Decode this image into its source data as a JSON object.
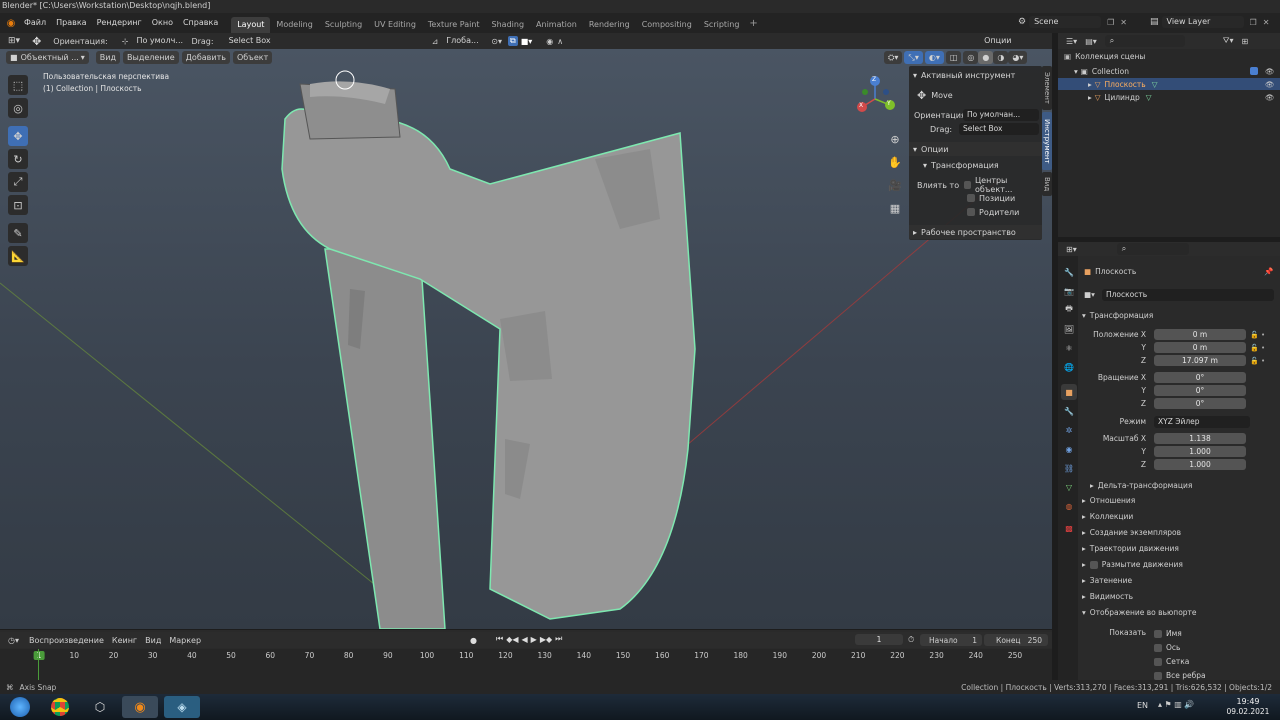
{
  "titlebar": {
    "text": "Blender* [C:\\Users\\Workstation\\Desktop\\nqjh.blend]"
  },
  "menu": [
    "Файл",
    "Правка",
    "Рендеринг",
    "Окно",
    "Справка"
  ],
  "workspaces": [
    "Layout",
    "Modeling",
    "Sculpting",
    "UV Editing",
    "Texture Paint",
    "Shading",
    "Animation",
    "Rendering",
    "Compositing",
    "Scripting"
  ],
  "scene": {
    "name": "Scene",
    "view_layer": "View Layer"
  },
  "header": {
    "orientation_label": "Ориентация:",
    "orientation_value": "По умолч...",
    "drag_label": "Drag:",
    "drag_value": "Select Box",
    "transform_space": "Глоба...",
    "options": "Опции"
  },
  "viewport_header": {
    "mode": "Объектный ...",
    "items": [
      "Вид",
      "Выделение",
      "Добавить",
      "Объект"
    ]
  },
  "viewport": {
    "perspective": "Пользовательская перспектива",
    "collection_info": "(1) Collection | Плоскость",
    "axes": {
      "x": "X",
      "y": "Y",
      "z": "Z"
    }
  },
  "colors": {
    "accent": "#4a7fd1",
    "selection_outline": "#7ee8b0",
    "active_tab": "#3f6fb5"
  },
  "npanel": {
    "active_tool_title": "Активный инструмент",
    "tool_name": "Move",
    "orientation_label": "Ориентация",
    "orientation_value": "По умолчан...",
    "drag_label": "Drag:",
    "drag_value": "Select Box",
    "options_title": "Опции",
    "transform_title": "Трансформация",
    "affect_label": "Влиять то...",
    "affect_items": [
      "Центры объект...",
      "Позиции",
      "Родители"
    ],
    "workspace_title": "Рабочее пространство",
    "tabs": [
      "Элемент",
      "Инструмент",
      "Вид"
    ]
  },
  "outliner": {
    "scene_collection": "Коллекция сцены",
    "items": [
      {
        "name": "Collection"
      },
      {
        "name": "Плоскость"
      },
      {
        "name": "Цилиндр"
      }
    ]
  },
  "properties": {
    "object_name": "Плоскость",
    "object_field": "Плоскость",
    "section_transform": "Трансформация",
    "location_label": "Положение X",
    "location": [
      "0 m",
      "0 m",
      "17.097 m"
    ],
    "rotation_label": "Вращение X",
    "rotation": [
      "0°",
      "0°",
      "0°"
    ],
    "mode_label": "Режим",
    "mode_value": "XYZ Эйлер",
    "scale_label": "Масштаб X",
    "scale": [
      "1.138",
      "1.000",
      "1.000"
    ],
    "axis_y": "Y",
    "axis_z": "Z",
    "delta": "Дельта-трансформация",
    "sections": [
      "Отношения",
      "Коллекции",
      "Создание экземпляров",
      "Траектории движения",
      "Размытие движения",
      "Затенение",
      "Видимость",
      "Отображение во вьюпорте"
    ],
    "show_label": "Показать",
    "show_items": [
      "Имя",
      "Ось",
      "Сетка",
      "Все ребра"
    ]
  },
  "timeline": {
    "menus": [
      "Воспроизведение",
      "Кеинг",
      "Вид",
      "Маркер"
    ],
    "current_frame": "1",
    "start_label": "Начало",
    "start": "1",
    "end_label": "Конец",
    "end": "250",
    "ticks": [
      "1",
      "10",
      "20",
      "30",
      "40",
      "50",
      "60",
      "70",
      "80",
      "90",
      "100",
      "110",
      "120",
      "130",
      "140",
      "150",
      "160",
      "170",
      "180",
      "190",
      "200",
      "210",
      "220",
      "230",
      "240",
      "250"
    ]
  },
  "status": {
    "left": "Axis Snap",
    "right": "Collection | Плоскость | Verts:313,270 | Faces:313,291 | Tris:626,532 | Objects:1/2"
  },
  "taskbar": {
    "lang": "EN",
    "time": "19:49",
    "date": "09.02.2021"
  }
}
